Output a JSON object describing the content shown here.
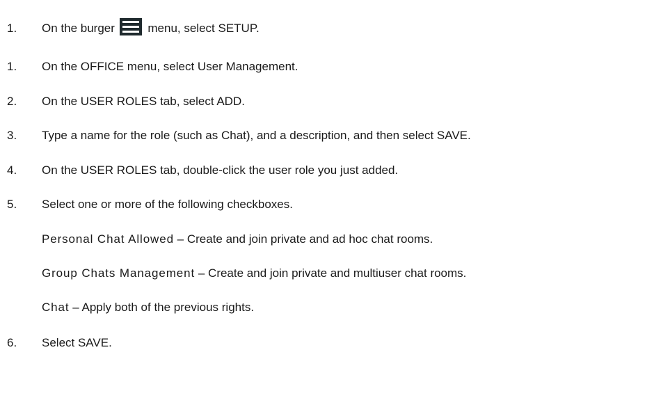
{
  "steps": [
    {
      "number": "1.",
      "before_icon": "On the burger",
      "icon": "burger-menu-icon",
      "after_icon": "menu, select SETUP."
    },
    {
      "number": "1.",
      "text": "On the OFFICE menu, select User Management."
    },
    {
      "number": "2.",
      "text": "On the USER ROLES tab, select ADD."
    },
    {
      "number": "3.",
      "text": "Type a name for the role (such as Chat), and a description, and then select SAVE."
    },
    {
      "number": "4.",
      "text": "On the USER ROLES tab, double-click the user role you just added."
    },
    {
      "number": "5.",
      "text": "Select one or more of the following checkboxes."
    },
    {
      "number": "6.",
      "text": "Select SAVE."
    }
  ],
  "checkbox_options": [
    {
      "term": "Personal Chat Allowed",
      "description": " – Create and join private and ad hoc chat rooms."
    },
    {
      "term": "Group Chats Management",
      "description": " – Create and join private and multiuser chat rooms."
    },
    {
      "term": "Chat",
      "description": " – Apply both of the previous rights."
    }
  ],
  "colors": {
    "text": "#1a1a1a",
    "icon_background": "#1f2a2e",
    "icon_bars": "#ffffff"
  }
}
